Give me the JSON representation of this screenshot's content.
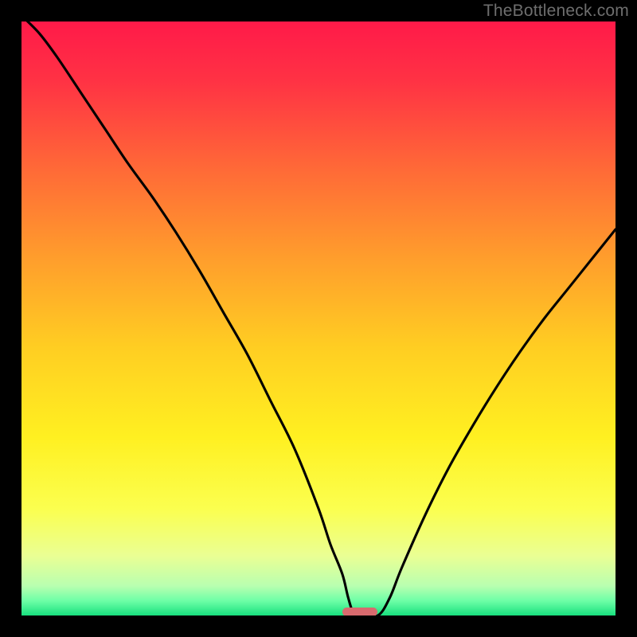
{
  "watermark": "TheBottleneck.com",
  "chart_data": {
    "type": "line",
    "title": "",
    "xlabel": "",
    "ylabel": "",
    "xlim": [
      0,
      100
    ],
    "ylim": [
      0,
      100
    ],
    "gradient_stops": [
      {
        "pos": 0.0,
        "color": "#ff1a49"
      },
      {
        "pos": 0.1,
        "color": "#ff3244"
      },
      {
        "pos": 0.25,
        "color": "#ff6a37"
      },
      {
        "pos": 0.4,
        "color": "#ff9e2c"
      },
      {
        "pos": 0.55,
        "color": "#ffce22"
      },
      {
        "pos": 0.7,
        "color": "#fff021"
      },
      {
        "pos": 0.82,
        "color": "#fbff4f"
      },
      {
        "pos": 0.9,
        "color": "#eaff94"
      },
      {
        "pos": 0.95,
        "color": "#b9ffb0"
      },
      {
        "pos": 0.975,
        "color": "#6fffa7"
      },
      {
        "pos": 1.0,
        "color": "#18e07e"
      }
    ],
    "series": [
      {
        "name": "bottleneck-curve",
        "x": [
          0,
          3,
          6,
          10,
          14,
          18,
          22,
          26,
          30,
          34,
          38,
          42,
          46,
          50,
          52,
          54,
          55,
          56,
          57,
          60,
          62,
          64,
          68,
          72,
          76,
          80,
          84,
          88,
          92,
          96,
          100
        ],
        "y": [
          101,
          98,
          94,
          88,
          82,
          76,
          70.5,
          64.5,
          58,
          51,
          44,
          36,
          28,
          18,
          12,
          7,
          3,
          0,
          0,
          0,
          3,
          8,
          17,
          25,
          32,
          38.5,
          44.5,
          50,
          55,
          60,
          65
        ]
      }
    ],
    "marker": {
      "x_center": 57,
      "y": 0,
      "width_pct": 5.9,
      "height_pct": 1.6,
      "color": "#d86a6e"
    }
  }
}
